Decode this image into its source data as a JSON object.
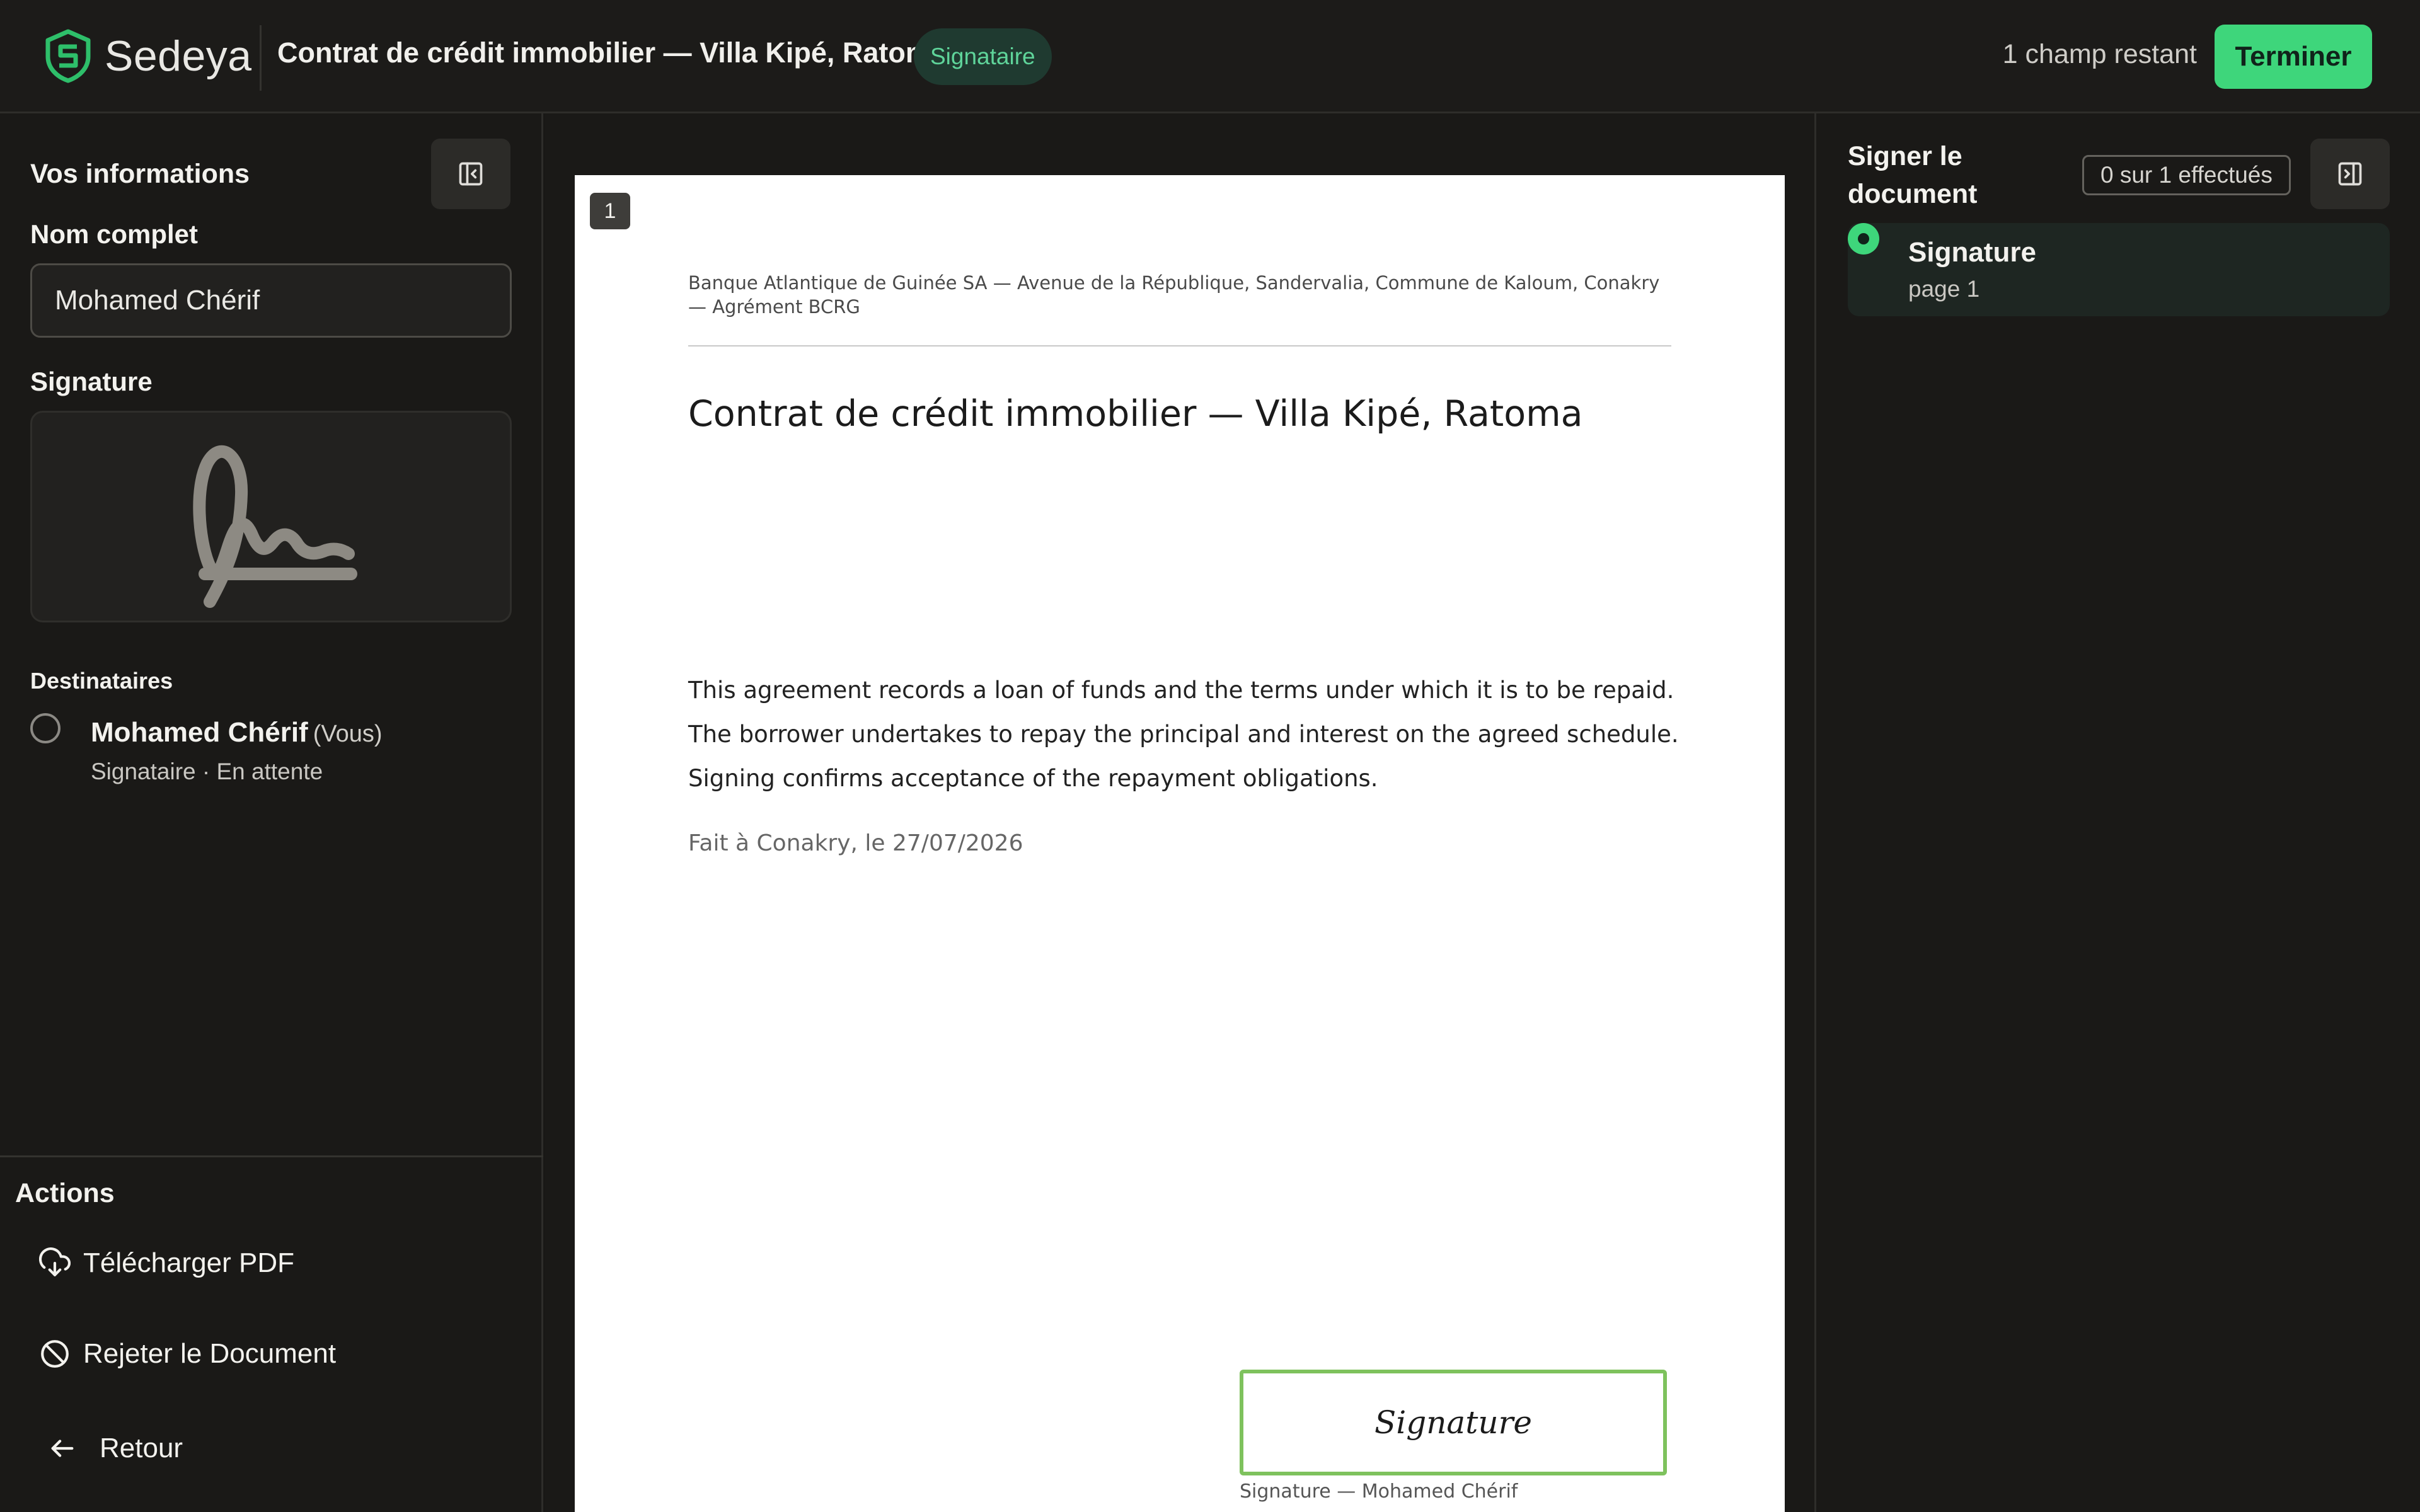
{
  "app": {
    "name": "Sedeya"
  },
  "header": {
    "document_title": "Contrat de crédit immobilier — Villa Kipé, Ratoma",
    "role_badge": "Signataire",
    "remaining": "1 champ restant",
    "finish_label": "Terminer"
  },
  "left_panel": {
    "title": "Vos informations",
    "full_name_label": "Nom complet",
    "full_name_value": "Mohamed Chérif",
    "signature_label": "Signature",
    "recipients_title": "Destinataires",
    "recipient": {
      "name": "Mohamed Chérif",
      "you_tag": "(Vous)",
      "status": "Signataire · En attente"
    },
    "actions_title": "Actions",
    "actions": {
      "download": "Télécharger PDF",
      "reject": "Rejeter le Document",
      "back": "Retour"
    }
  },
  "document": {
    "page_number": "1",
    "letterhead": "Banque Atlantique de Guinée SA — Avenue de la République, Sandervalia, Commune de Kaloum, Conakry — Agrément BCRG",
    "heading": "Contrat de crédit immobilier — Villa Kipé, Ratoma",
    "body": [
      "This agreement records a loan of funds and the terms under which it is to be repaid.",
      "The borrower undertakes to repay the principal and interest on the agreed schedule.",
      "Signing confirms acceptance of the repayment obligations."
    ],
    "date_line": "Fait à Conakry, le 27/07/2026",
    "signature_field_label": "Signature",
    "signature_caption": "Signature — Mohamed Chérif"
  },
  "right_panel": {
    "title": "Signer le document",
    "progress": "0 sur 1 effectués",
    "fields": [
      {
        "label": "Signature",
        "page": "page 1"
      }
    ]
  },
  "colors": {
    "accent": "#3ed67b",
    "badge_bg": "#1f3a30",
    "field_border": "#7ec25d",
    "background": "#191816"
  },
  "icons": [
    "sedeya-logo-icon",
    "sidebar-collapse-icon",
    "sidebar-expand-icon",
    "download-cloud-icon",
    "ban-icon",
    "arrow-left-icon"
  ]
}
